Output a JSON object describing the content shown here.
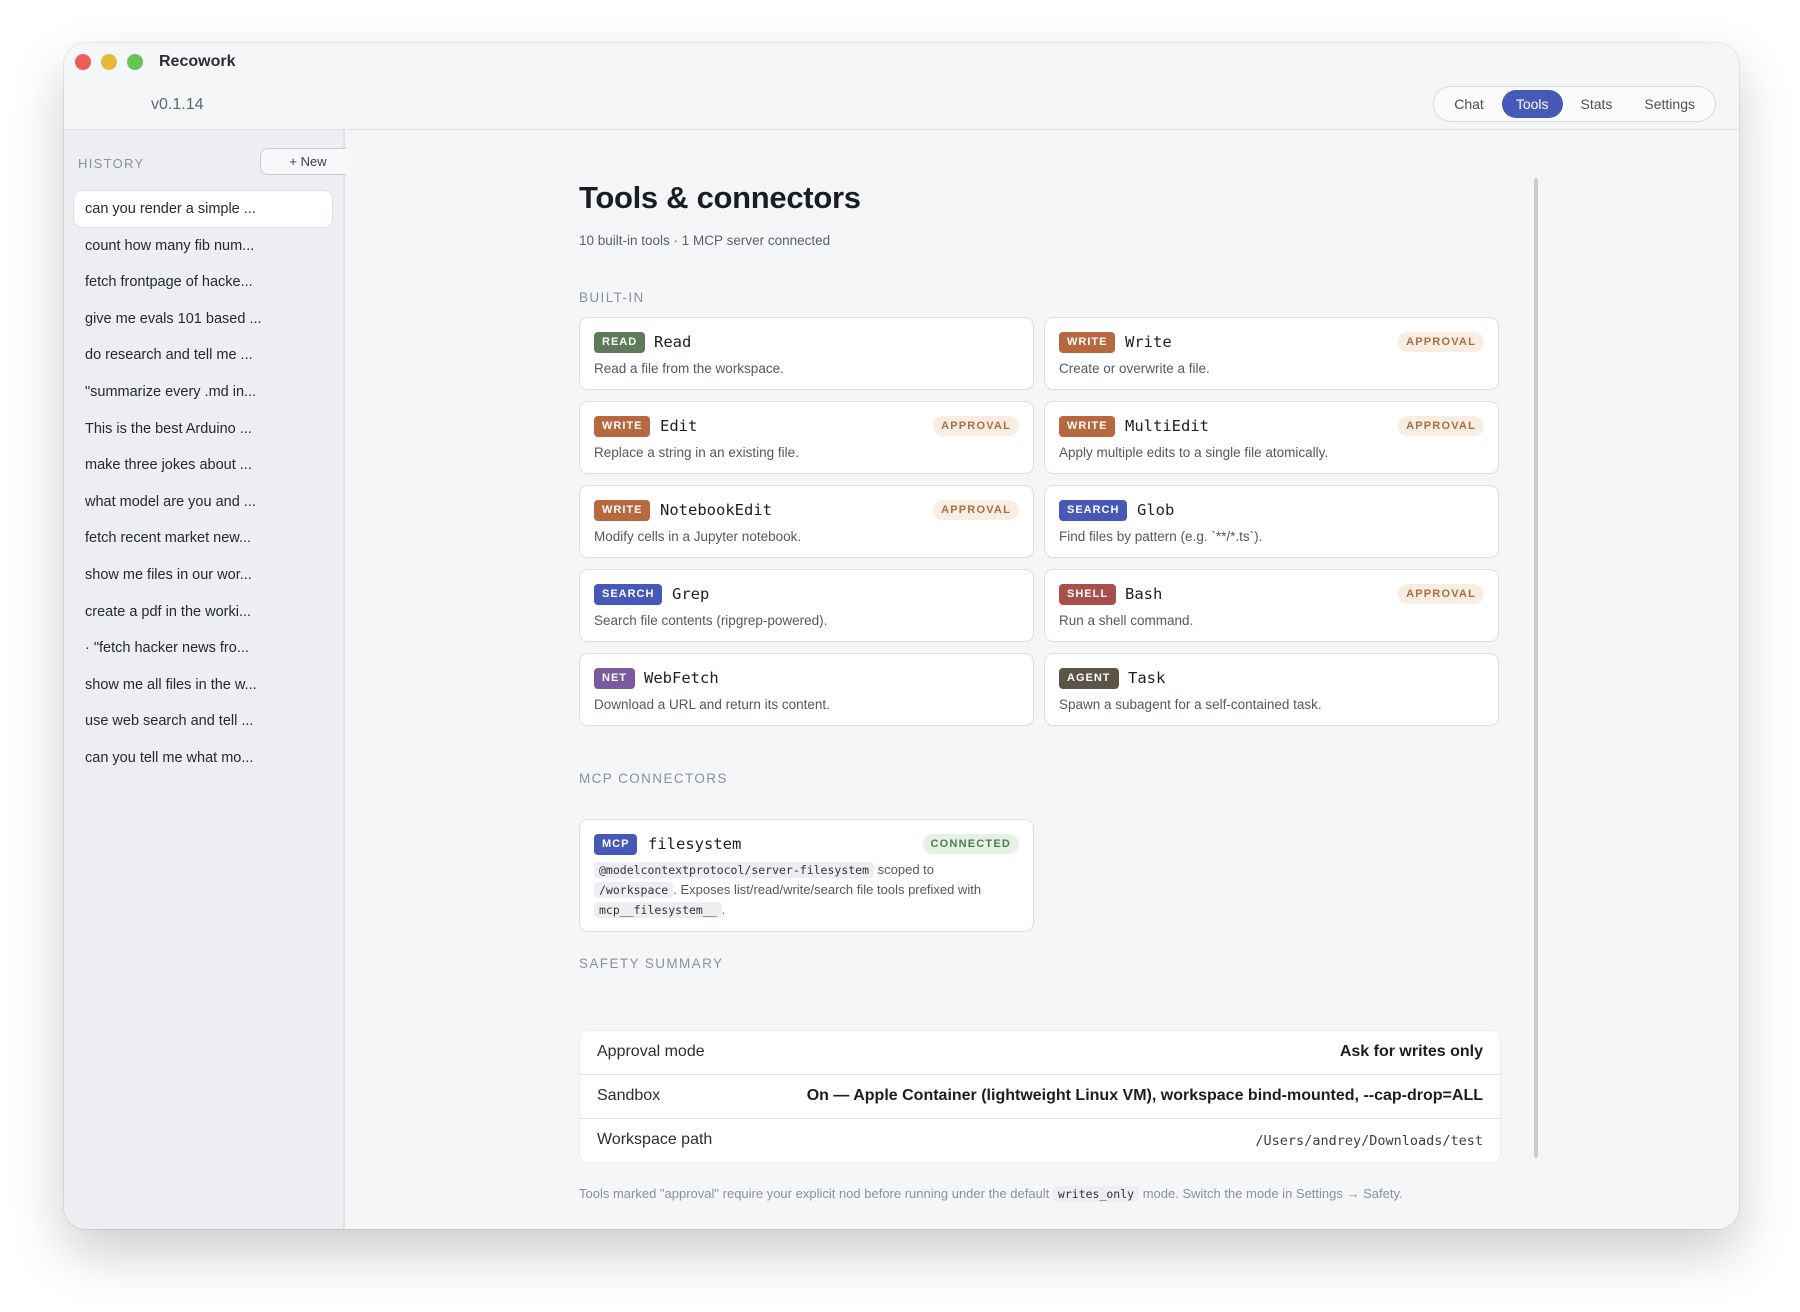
{
  "app": {
    "title": "Recowork",
    "version": "v0.1.14"
  },
  "nav": {
    "tabs": [
      "Chat",
      "Tools",
      "Stats",
      "Settings"
    ],
    "active": "Tools"
  },
  "sidebar": {
    "label": "HISTORY",
    "new_button": "+ New",
    "items": [
      "can you render a simple ...",
      "count how many fib num...",
      "fetch frontpage of hacke...",
      "give me evals 101 based ...",
      "do research and tell me ...",
      "\"summarize every .md in...",
      "This is the best Arduino ...",
      "make three jokes about ...",
      "what model are you and ...",
      "fetch recent market new...",
      "show me files in our wor...",
      "create a pdf in the worki...",
      "· \"fetch hacker news fro...",
      "show me all files in the w...",
      "use web search and tell ...",
      "can you tell me what mo..."
    ]
  },
  "page": {
    "title": "Tools & connectors",
    "subtitle": "10 built-in tools · 1 MCP server connected",
    "builtin_label": "BUILT-IN",
    "mcp_label": "MCP CONNECTORS",
    "safety_label": "SAFETY SUMMARY"
  },
  "tools": [
    {
      "badge": "READ",
      "name": "Read",
      "desc": "Read a file from the workspace.",
      "approval": ""
    },
    {
      "badge": "WRITE",
      "name": "Write",
      "desc": "Create or overwrite a file.",
      "approval": "APPROVAL"
    },
    {
      "badge": "WRITE",
      "name": "Edit",
      "desc": "Replace a string in an existing file.",
      "approval": "APPROVAL"
    },
    {
      "badge": "WRITE",
      "name": "MultiEdit",
      "desc": "Apply multiple edits to a single file atomically.",
      "approval": "APPROVAL"
    },
    {
      "badge": "WRITE",
      "name": "NotebookEdit",
      "desc": "Modify cells in a Jupyter notebook.",
      "approval": "APPROVAL"
    },
    {
      "badge": "SEARCH",
      "name": "Glob",
      "desc": "Find files by pattern (e.g. `**/*.ts`).",
      "approval": ""
    },
    {
      "badge": "SEARCH",
      "name": "Grep",
      "desc": "Search file contents (ripgrep-powered).",
      "approval": ""
    },
    {
      "badge": "SHELL",
      "name": "Bash",
      "desc": "Run a shell command.",
      "approval": "APPROVAL"
    },
    {
      "badge": "NET",
      "name": "WebFetch",
      "desc": "Download a URL and return its content.",
      "approval": ""
    },
    {
      "badge": "AGENT",
      "name": "Task",
      "desc": "Spawn a subagent for a self-contained task.",
      "approval": ""
    }
  ],
  "mcp": {
    "badge": "MCP",
    "name": "filesystem",
    "status": "CONNECTED",
    "package": "@modelcontextprotocol/server-filesystem",
    "text1": " scoped to",
    "path": "/workspace",
    "text2": ". Exposes list/read/write/search file tools prefixed with",
    "prefix": "mcp__filesystem__",
    "text3": "."
  },
  "safety": [
    {
      "key": "Approval mode",
      "value": "Ask for writes only"
    },
    {
      "key": "Sandbox",
      "value": "On — Apple Container (lightweight Linux VM), workspace bind-mounted, --cap-drop=ALL"
    },
    {
      "key": "Workspace path",
      "value": "/Users/andrey/Downloads/test"
    }
  ],
  "footnote": {
    "before": "Tools marked \"approval\" require your explicit nod before running under the default",
    "mode": "writes_only",
    "after": "mode. Switch the mode in Settings → Safety."
  }
}
